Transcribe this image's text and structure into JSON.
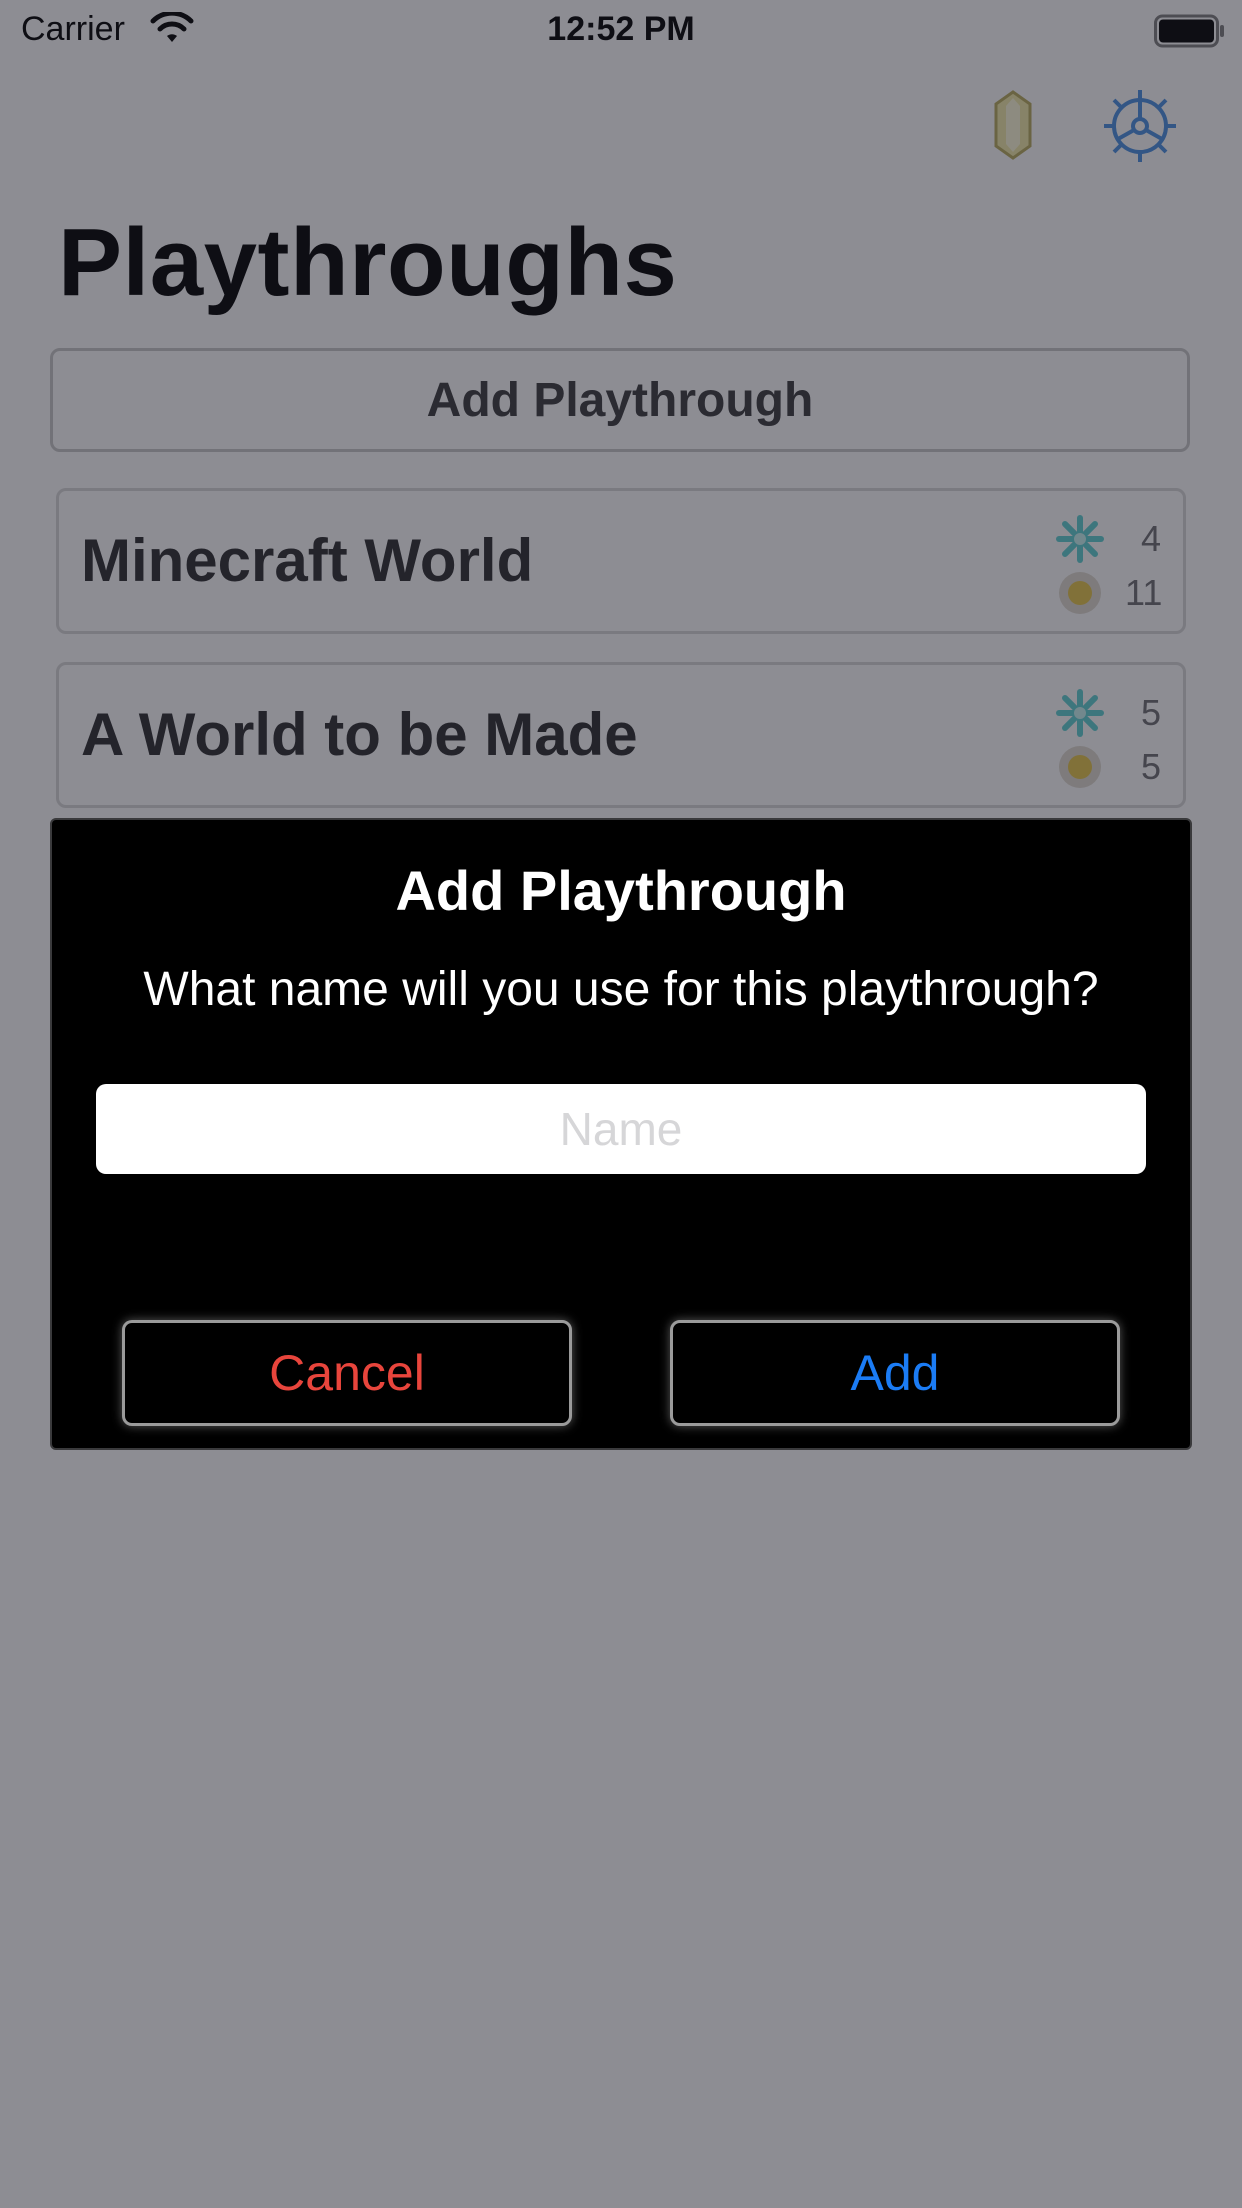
{
  "status_bar": {
    "carrier": "Carrier",
    "time": "12:52 PM"
  },
  "nav": {
    "icons": [
      "crystal-icon",
      "gear-icon"
    ]
  },
  "page": {
    "title": "Playthroughs",
    "add_button_label": "Add Playthrough"
  },
  "playthroughs": [
    {
      "name": "Minecraft World",
      "stat_a": "4",
      "stat_b": "11"
    },
    {
      "name": "A World to be Made",
      "stat_a": "5",
      "stat_b": "5"
    }
  ],
  "dialog": {
    "title": "Add Playthrough",
    "message": "What name will you use for this playthrough?",
    "input_placeholder": "Name",
    "input_value": "",
    "cancel_label": "Cancel",
    "add_label": "Add"
  },
  "colors": {
    "cancel": "#e8453c",
    "add": "#1b7cf5",
    "gear": "#4a90e2",
    "crystal": "#f0e6a8"
  }
}
